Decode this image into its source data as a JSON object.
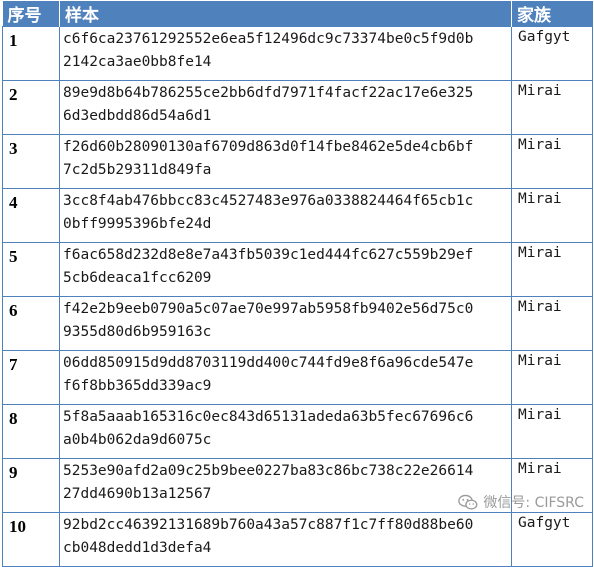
{
  "table": {
    "headers": {
      "index": "序号",
      "sample": "样本",
      "family": "家族"
    },
    "rows": [
      {
        "index": "1",
        "hash_line1": "c6f6ca23761292552e6ea5f12496dc9c73374be0c5f9d0b",
        "hash_line2": "2142ca3ae0bb8fe14",
        "family": "Gafgyt"
      },
      {
        "index": "2",
        "hash_line1": "89e9d8b64b786255ce2bb6dfd7971f4facf22ac17e6e325",
        "hash_line2": "6d3edbdd86d54a6d1",
        "family": "Mirai"
      },
      {
        "index": "3",
        "hash_line1": "f26d60b28090130af6709d863d0f14fbe8462e5de4cb6bf",
        "hash_line2": "7c2d5b29311d849fa",
        "family": "Mirai"
      },
      {
        "index": "4",
        "hash_line1": "3cc8f4ab476bbcc83c4527483e976a0338824464f65cb1c",
        "hash_line2": "0bff9995396bfe24d",
        "family": "Mirai"
      },
      {
        "index": "5",
        "hash_line1": "f6ac658d232d8e8e7a43fb5039c1ed444fc627c559b29ef",
        "hash_line2": "5cb6deaca1fcc6209",
        "family": "Mirai"
      },
      {
        "index": "6",
        "hash_line1": "f42e2b9eeb0790a5c07ae70e997ab5958fb9402e56d75c0",
        "hash_line2": "9355d80d6b959163c",
        "family": "Mirai"
      },
      {
        "index": "7",
        "hash_line1": "06dd850915d9dd8703119dd400c744fd9e8f6a96cde547e",
        "hash_line2": "f6f8bb365dd339ac9",
        "family": "Mirai"
      },
      {
        "index": "8",
        "hash_line1": "5f8a5aaab165316c0ec843d65131adeda63b5fec67696c6",
        "hash_line2": "a0b4b062da9d6075c",
        "family": "Mirai"
      },
      {
        "index": "9",
        "hash_line1": "5253e90afd2a09c25b9bee0227ba83c86bc738c22e26614",
        "hash_line2": "27dd4690b13a12567",
        "family": "Mirai"
      },
      {
        "index": "10",
        "hash_line1": "92bd2cc46392131689b760a43a57c887f1c7ff80d88be60",
        "hash_line2": "cb048dedd1d3defa4",
        "family": "Gafgyt"
      }
    ]
  },
  "watermark": {
    "icon": "wechat-icon",
    "text": "微信号: CIFSRC"
  },
  "colors": {
    "header_bg": "#4f81bd",
    "grid": "#4f81bd",
    "header_text": "#ffffff"
  }
}
